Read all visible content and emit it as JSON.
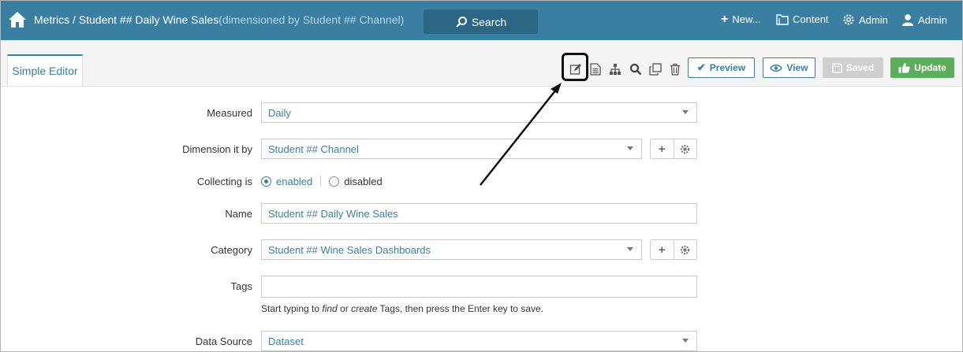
{
  "header": {
    "breadcrumb_main": "Metrics / Student ## Daily Wine Sales",
    "breadcrumb_dim": "(dimensioned by Student ## Channel)",
    "search_label": "Search",
    "new_label": "New...",
    "content_label": "Content",
    "admin_label": "Admin",
    "user_label": "Admin"
  },
  "tabs": {
    "simple_editor": "Simple Editor"
  },
  "toolbar": {
    "preview_label": "Preview",
    "view_label": "View",
    "saved_label": "Saved",
    "update_label": "Update"
  },
  "form": {
    "measured_label": "Measured",
    "measured_value": "Daily",
    "dimension_label": "Dimension it by",
    "dimension_value": "Student ## Channel",
    "collecting_label": "Collecting is",
    "enabled_label": "enabled",
    "disabled_label": "disabled",
    "name_label": "Name",
    "name_value": "Student ## Daily Wine Sales",
    "category_label": "Category",
    "category_value": "Student ## Wine Sales Dashboards",
    "tags_label": "Tags",
    "tags_value": "",
    "hint_prefix": "Start typing to ",
    "hint_find": "find",
    "hint_or": " or ",
    "hint_create": "create",
    "hint_suffix": " Tags, then press the Enter key to save.",
    "datasource_label": "Data Source",
    "datasource_value": "Dataset"
  },
  "colors": {
    "header_bg": "#3a7fa2",
    "accent": "#3a7fa2",
    "update_green": "#5cae5c"
  }
}
